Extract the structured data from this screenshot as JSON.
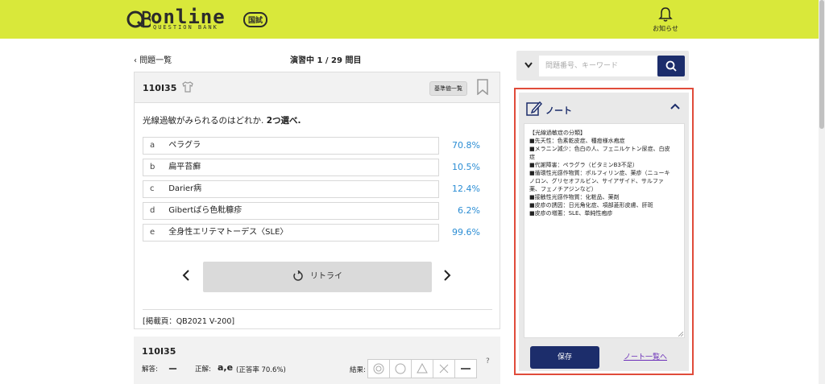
{
  "header": {
    "logo_text": "online",
    "logo_badge": "国試",
    "logo_sub": "QUESTION BANK",
    "notification_label": "お知らせ",
    "bg_color": "#d9e83a"
  },
  "nav": {
    "back_label": "問題一覧",
    "progress_title": "演習中 1 / 29 問目"
  },
  "question": {
    "id": "110I35",
    "basic_button": "基準値一覧",
    "text": "光線過敏がみられるのはどれか.",
    "select_count": "2つ選べ.",
    "choices": [
      {
        "letter": "a",
        "text": "ペラグラ",
        "pct": "70.8%"
      },
      {
        "letter": "b",
        "text": "扁平苔癬",
        "pct": "10.5%"
      },
      {
        "letter": "c",
        "text": "Darier病",
        "pct": "12.4%"
      },
      {
        "letter": "d",
        "text": "Gibertばら色粃糠疹",
        "pct": "6.2%"
      },
      {
        "letter": "e",
        "text": "全身性エリテマトーデス〈SLE〉",
        "pct": "99.6%"
      }
    ],
    "retry_label": "リトライ",
    "source": "[掲載頁：QB2021 V-200]"
  },
  "answer": {
    "id": "110I35",
    "answer_label": "解答:",
    "answer_value": "ー",
    "correct_label": "正解:",
    "correct_value": "a,e",
    "correct_rate": "(正答率 70.6%)",
    "result_label": "結果:",
    "help": "?"
  },
  "search": {
    "placeholder": "問題番号、キーワード"
  },
  "note": {
    "title": "ノート",
    "lines": [
      "【光線過敏症の分類】",
      "■先天性：色素乾皮症、種痘様水疱症",
      "■メラニン減少：色白の人、フェニルケトン尿症、白皮",
      "症",
      "■代謝障害：ペラグラ（ビタミンB3不足）",
      "■循環性光感作物質：ポルフィリン症、薬疹（ニューキ",
      "ノロン、グリセオフルビン、サイアザイド、サルファ",
      "薬、フェノチアジンなど）",
      "■接触性光感作物質：化粧品、薬剤",
      "■皮疹の誘因：日光角化症、項部菱形皮膚、肝斑",
      "■皮疹の増悪：SLE、単純性疱疹"
    ],
    "save_label": "保存",
    "list_link": "ノート一覧へ",
    "highlight_color": "#e04b3a"
  },
  "colors": {
    "accent": "#1c2d6b",
    "pct_blue": "#2b8dd4"
  }
}
